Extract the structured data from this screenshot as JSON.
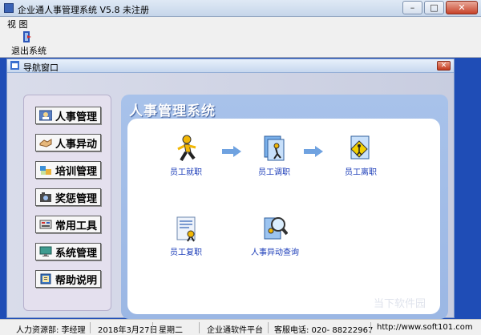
{
  "window": {
    "title": "企业通人事管理系统 V5.8   未注册",
    "minimize": "–",
    "maximize": "□",
    "close": "✕"
  },
  "menu": {
    "items": [
      "视 图"
    ]
  },
  "toolbar": {
    "exit_label": "退出系统"
  },
  "child_window": {
    "title": "导航窗口",
    "close": "✕"
  },
  "nav": {
    "items": [
      {
        "label": "人事管理",
        "icon": "person-card-icon"
      },
      {
        "label": "人事异动",
        "icon": "handshake-icon"
      },
      {
        "label": "培训管理",
        "icon": "puzzle-icon"
      },
      {
        "label": "奖惩管理",
        "icon": "camera-icon"
      },
      {
        "label": "常用工具",
        "icon": "tools-icon"
      },
      {
        "label": "系统管理",
        "icon": "monitor-icon"
      },
      {
        "label": "帮助说明",
        "icon": "help-book-icon"
      }
    ]
  },
  "content": {
    "header": "人事管理系统",
    "features": [
      {
        "label": "员工就职",
        "icon": "running-man-icon"
      },
      {
        "label": "员工调职",
        "icon": "document-transfer-icon"
      },
      {
        "label": "员工离职",
        "icon": "exit-sign-icon"
      },
      {
        "label": "员工复职",
        "icon": "document-return-icon"
      },
      {
        "label": "人事异动查询",
        "icon": "magnifier-icon"
      }
    ]
  },
  "status": {
    "department": "人力资源部: 李经理",
    "date": "2018年3月27日",
    "weekday": "星期二",
    "platform": "企业通软件平台",
    "phone": "客服电话: 020-  88222967",
    "url": "http://www.soft101.com"
  },
  "watermark": "当下软件园",
  "colors": {
    "workspace": "#1f4db6",
    "accent_text": "#1a3bb8",
    "panel": "#a8c2ea"
  }
}
